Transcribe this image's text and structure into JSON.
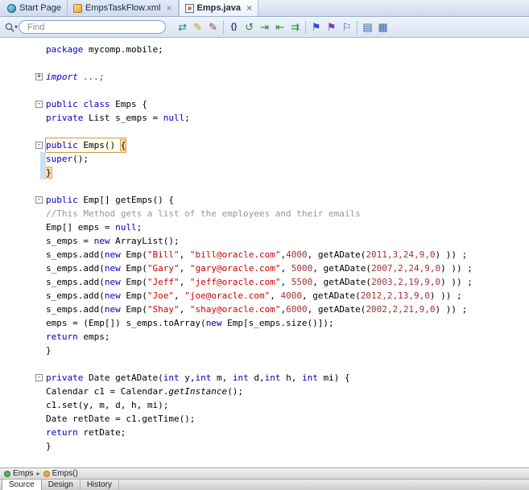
{
  "doc_tabs": [
    {
      "label": "Start Page",
      "icon": "start-page-icon",
      "closable": false,
      "active": false
    },
    {
      "label": "EmpsTaskFlow.xml",
      "icon": "taskflow-icon",
      "closable": true,
      "active": false
    },
    {
      "label": "Emps.java",
      "icon": "java-file-icon",
      "closable": true,
      "active": true
    }
  ],
  "toolbar": {
    "find": {
      "placeholder": "Find"
    },
    "icons": [
      {
        "name": "navigate-swap-icon",
        "glyph": "⇄",
        "color": "#0f7b8e"
      },
      {
        "name": "highlight-pen-icon",
        "glyph": "✎",
        "color": "#c99700"
      },
      {
        "name": "mark-pen-icon",
        "glyph": "✎",
        "color": "#b34040"
      },
      {
        "sep": true
      },
      {
        "name": "braces-icon",
        "glyph": "{}",
        "color": "#203a8f",
        "small": true
      },
      {
        "name": "reformat-icon",
        "glyph": "↺",
        "color": "#2e8b2e"
      },
      {
        "name": "indent-icon",
        "glyph": "⇥",
        "color": "#2e8b2e"
      },
      {
        "name": "outdent-icon",
        "glyph": "⇤",
        "color": "#2e8b2e"
      },
      {
        "name": "move-block-icon",
        "glyph": "⇉",
        "color": "#2e8b2e"
      },
      {
        "sep": true
      },
      {
        "name": "toggle-bookmark-icon",
        "glyph": "⚑",
        "color": "#274bdb"
      },
      {
        "name": "next-bookmark-icon",
        "glyph": "⚑",
        "color": "#7a3fb0"
      },
      {
        "name": "prev-bookmark-icon",
        "glyph": "⚐",
        "color": "#274bdb"
      },
      {
        "sep": true
      },
      {
        "name": "code-preview-icon",
        "glyph": "▤",
        "color": "#3b5fa0"
      },
      {
        "name": "quick-outline-icon",
        "glyph": "▦",
        "color": "#3b5fa0"
      }
    ]
  },
  "editor": {
    "lines": [
      {
        "tokens": [
          [
            "k",
            "package"
          ],
          [
            "p",
            " mycomp.mobile;"
          ]
        ]
      },
      {
        "tokens": []
      },
      {
        "fold": "+",
        "tokens": [
          [
            "ki",
            "import"
          ],
          [
            "pi",
            " ...;"
          ]
        ]
      },
      {
        "tokens": []
      },
      {
        "fold": "-",
        "tokens": [
          [
            "k",
            "public class"
          ],
          [
            "p",
            " Emps {"
          ]
        ]
      },
      {
        "tokens": [
          [
            "k",
            "private"
          ],
          [
            "p",
            " List s_emps = "
          ],
          [
            "k",
            "null"
          ],
          [
            "p",
            ";"
          ]
        ]
      },
      {
        "tokens": []
      },
      {
        "fold": "-",
        "box": true,
        "tokens": [
          [
            "k",
            "public"
          ],
          [
            "p",
            " Emps() "
          ],
          [
            "bh",
            "{"
          ]
        ]
      },
      {
        "strip": true,
        "tokens": [
          [
            "k",
            "super"
          ],
          [
            "p",
            "();"
          ]
        ]
      },
      {
        "strip": true,
        "tokens": [
          [
            "bh",
            "}"
          ]
        ]
      },
      {
        "tokens": []
      },
      {
        "fold": "-",
        "tokens": [
          [
            "k",
            "public"
          ],
          [
            "p",
            " Emp[] getEmps() {"
          ]
        ]
      },
      {
        "tokens": [
          [
            "c",
            "//This Method gets a list of the employees and their emails"
          ]
        ]
      },
      {
        "tokens": [
          [
            "p",
            "Emp[] emps = "
          ],
          [
            "k",
            "null"
          ],
          [
            "p",
            ";"
          ]
        ]
      },
      {
        "tokens": [
          [
            "p",
            "s_emps = "
          ],
          [
            "k",
            "new"
          ],
          [
            "p",
            " ArrayList();"
          ]
        ]
      },
      {
        "tokens": [
          [
            "p",
            "s_emps.add("
          ],
          [
            "k",
            "new"
          ],
          [
            "p",
            " Emp("
          ],
          [
            "s",
            "\"Bill\""
          ],
          [
            "p",
            ", "
          ],
          [
            "s",
            "\"bill@oracle.com\""
          ],
          [
            "p",
            ","
          ],
          [
            "n",
            "4000"
          ],
          [
            "p",
            ", getADate("
          ],
          [
            "n",
            "2011,3,24,9,0"
          ],
          [
            "p",
            ") )) ;"
          ]
        ]
      },
      {
        "tokens": [
          [
            "p",
            "s_emps.add("
          ],
          [
            "k",
            "new"
          ],
          [
            "p",
            " Emp("
          ],
          [
            "s",
            "\"Gary\""
          ],
          [
            "p",
            ", "
          ],
          [
            "s",
            "\"gary@oracle.com\""
          ],
          [
            "p",
            ", "
          ],
          [
            "n",
            "5000"
          ],
          [
            "p",
            ", getADate("
          ],
          [
            "n",
            "2007,2,24,9,0"
          ],
          [
            "p",
            ") )) ;"
          ]
        ]
      },
      {
        "tokens": [
          [
            "p",
            "s_emps.add("
          ],
          [
            "k",
            "new"
          ],
          [
            "p",
            " Emp("
          ],
          [
            "s",
            "\"Jeff\""
          ],
          [
            "p",
            ", "
          ],
          [
            "s",
            "\"jeff@oracle.com\""
          ],
          [
            "p",
            ", "
          ],
          [
            "n",
            "5500"
          ],
          [
            "p",
            ", getADate("
          ],
          [
            "n",
            "2003,2,19,9,0"
          ],
          [
            "p",
            ") )) ;"
          ]
        ]
      },
      {
        "tokens": [
          [
            "p",
            "s_emps.add("
          ],
          [
            "k",
            "new"
          ],
          [
            "p",
            " Emp("
          ],
          [
            "s",
            "\"Joe\""
          ],
          [
            "p",
            ", "
          ],
          [
            "s",
            "\"joe@oracle.com\""
          ],
          [
            "p",
            ", "
          ],
          [
            "n",
            "4000"
          ],
          [
            "p",
            ", getADate("
          ],
          [
            "n",
            "2012,2,13,9,0"
          ],
          [
            "p",
            ") )) ;"
          ]
        ]
      },
      {
        "tokens": [
          [
            "p",
            "s_emps.add("
          ],
          [
            "k",
            "new"
          ],
          [
            "p",
            " Emp("
          ],
          [
            "s",
            "\"Shay\""
          ],
          [
            "p",
            ", "
          ],
          [
            "s",
            "\"shay@oracle.com\""
          ],
          [
            "p",
            ","
          ],
          [
            "n",
            "6000"
          ],
          [
            "p",
            ", getADate("
          ],
          [
            "n",
            "2002,2,21,9,0"
          ],
          [
            "p",
            ") )) ;"
          ]
        ]
      },
      {
        "tokens": [
          [
            "p",
            "emps = (Emp[]) s_emps.toArray("
          ],
          [
            "k",
            "new"
          ],
          [
            "p",
            " Emp[s_emps.size()]);"
          ]
        ]
      },
      {
        "tokens": [
          [
            "k",
            "return"
          ],
          [
            "p",
            " emps;"
          ]
        ]
      },
      {
        "tokens": [
          [
            "p",
            "}"
          ]
        ]
      },
      {
        "tokens": []
      },
      {
        "fold": "-",
        "tokens": [
          [
            "k",
            "private"
          ],
          [
            "p",
            " Date getADate("
          ],
          [
            "k",
            "int"
          ],
          [
            "p",
            " y,"
          ],
          [
            "k",
            "int"
          ],
          [
            "p",
            " m, "
          ],
          [
            "k",
            "int"
          ],
          [
            "p",
            " d,"
          ],
          [
            "k",
            "int"
          ],
          [
            "p",
            " h, "
          ],
          [
            "k",
            "int"
          ],
          [
            "p",
            " mi) {"
          ]
        ]
      },
      {
        "tokens": [
          [
            "p",
            "Calendar c1 = Calendar."
          ],
          [
            "m",
            "getInstance"
          ],
          [
            "p",
            "();"
          ]
        ]
      },
      {
        "tokens": [
          [
            "p",
            "c1.set(y, m, d, h, mi);"
          ]
        ]
      },
      {
        "tokens": [
          [
            "p",
            "Date retDate = c1.getTime();"
          ]
        ]
      },
      {
        "tokens": [
          [
            "k",
            "return"
          ],
          [
            "p",
            " retDate;"
          ]
        ]
      },
      {
        "tokens": [
          [
            "p",
            "}"
          ]
        ]
      }
    ]
  },
  "breadcrumb": {
    "items": [
      {
        "label": "Emps",
        "icon": "class-icon"
      },
      {
        "label": "Emps()",
        "icon": "method-icon"
      }
    ]
  },
  "bottom_tabs": {
    "items": [
      "Source",
      "Design",
      "History"
    ],
    "active_index": 0
  }
}
